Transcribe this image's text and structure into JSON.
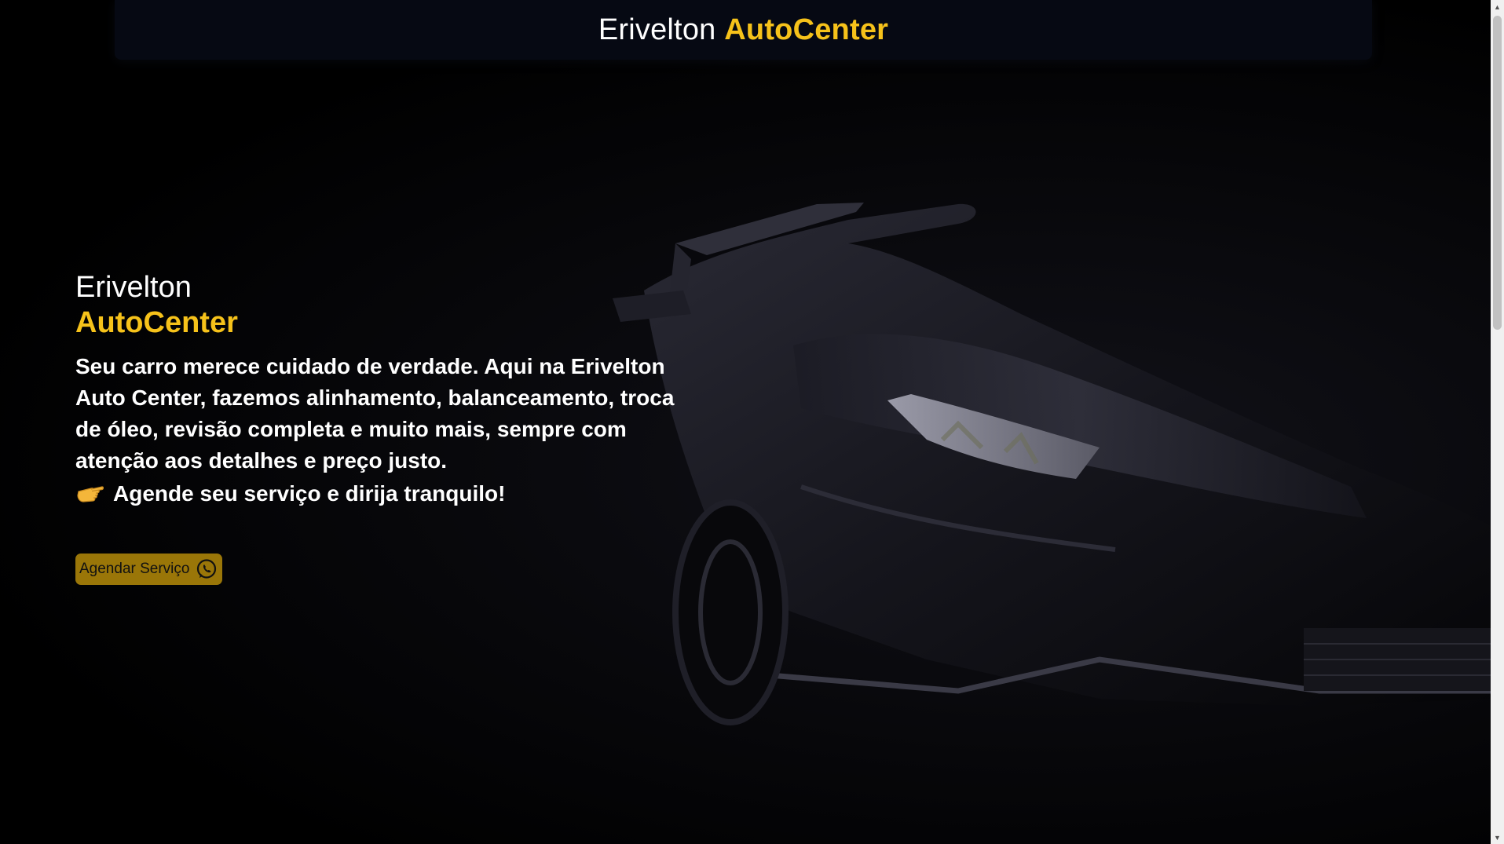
{
  "header": {
    "brand_main": "Erivelton",
    "brand_accent": "AutoCenter"
  },
  "hero": {
    "title_line1": "Erivelton",
    "title_line2": "AutoCenter",
    "description": "Seu carro merece cuidado de verdade. Aqui na Erivelton Auto Center, fazemos alinhamento, balanceamento, troca de óleo, revisão completa e muito mais, sempre com atenção aos detalhes e preço justo.",
    "cta_line": "Agende seu serviço e dirija tranquilo!",
    "cta_line_icon": "pointing-hand-icon",
    "button_label": "Agendar Serviço",
    "button_icon": "whatsapp-icon"
  },
  "colors": {
    "accent": "#f6c21a",
    "button_bg": "#9a7608",
    "header_bg": "#060913",
    "page_bg": "#000000"
  }
}
